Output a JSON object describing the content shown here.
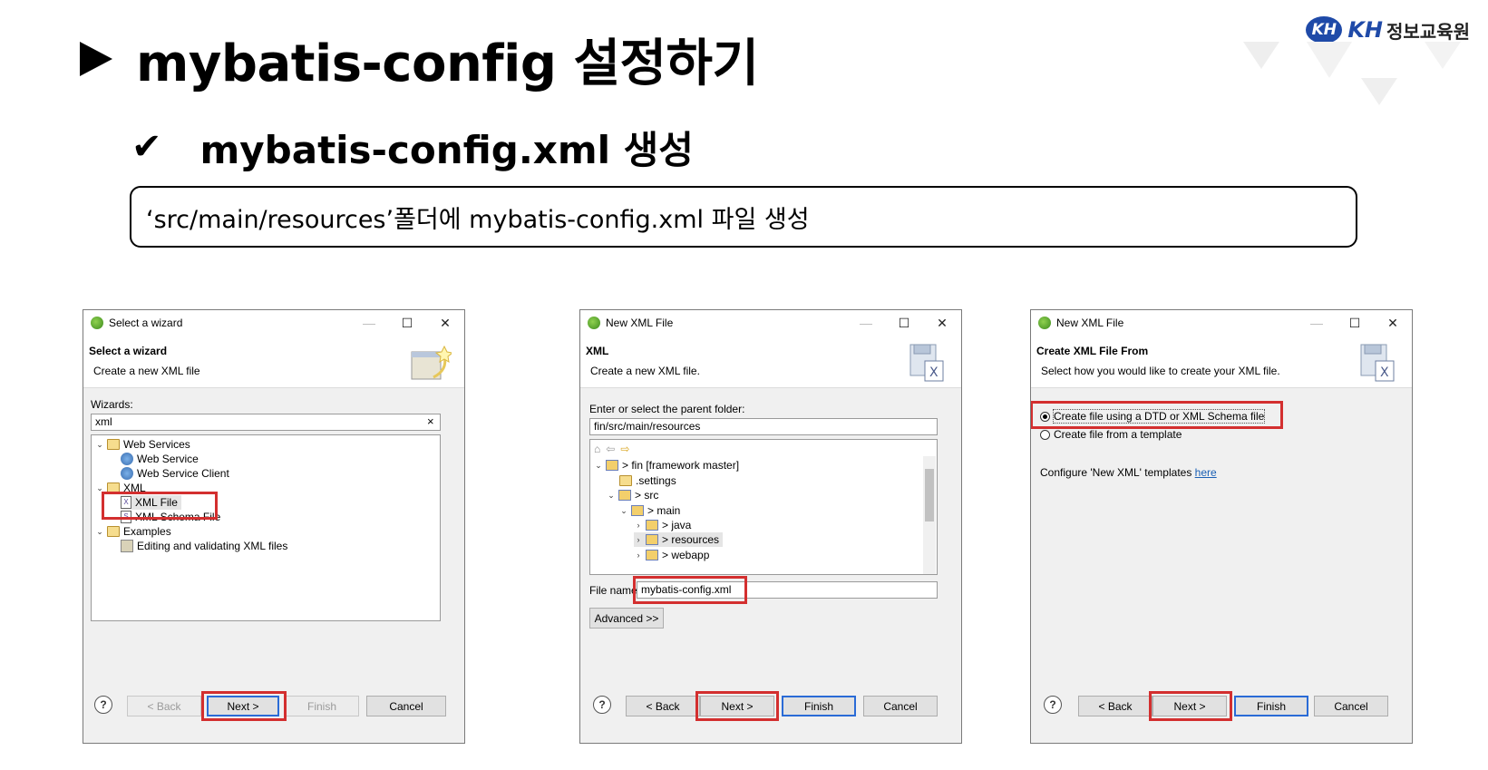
{
  "slide": {
    "title": "mybatis-config 설정하기",
    "subtitle_check": "✔",
    "subtitle": "mybatis-config.xml 생성",
    "note": "‘src/main/resources’폴더에 mybatis-config.xml 파일 생성",
    "logo": {
      "badge": "KH",
      "brand": "KH",
      "name": "정보교육원"
    }
  },
  "dialog1": {
    "window_title": "Select a wizard",
    "header_title": "Select a wizard",
    "header_desc": "Create a new XML file",
    "filter_label": "Wizards:",
    "filter_value": "xml",
    "filter_clear": "×",
    "tree": [
      {
        "label": "Web Services",
        "icon": "folder-open-icon",
        "chev": "⌄"
      },
      {
        "label": "Web Service",
        "icon": "web-service-icon"
      },
      {
        "label": "Web Service Client",
        "icon": "web-service-client-icon"
      },
      {
        "label": "XML",
        "icon": "folder-open-icon",
        "chev": "⌄"
      },
      {
        "label": "XML File",
        "icon": "xml-file-icon"
      },
      {
        "label": "XML Schema File",
        "icon": "xml-schema-icon"
      },
      {
        "label": "Examples",
        "icon": "folder-open-icon",
        "chev": "⌄"
      },
      {
        "label": "Editing and validating XML files",
        "icon": "example-icon"
      }
    ],
    "buttons": {
      "help": "?",
      "back": "< Back",
      "next": "Next >",
      "finish": "Finish",
      "cancel": "Cancel"
    }
  },
  "dialog2": {
    "window_title": "New XML File",
    "header_title": "XML",
    "header_desc": "Create a new XML file.",
    "parent_label": "Enter or select the parent folder:",
    "parent_value": "fin/src/main/resources",
    "tree": [
      {
        "label": "> fin [framework master]",
        "icon": "project-icon",
        "chev": "⌄"
      },
      {
        "label": ".settings",
        "icon": "folder-icon"
      },
      {
        "label": "> src",
        "icon": "folder-icon",
        "chev": "⌄"
      },
      {
        "label": "> main",
        "icon": "folder-icon",
        "chev": "⌄"
      },
      {
        "label": "> java",
        "icon": "folder-icon",
        "chev": "›"
      },
      {
        "label": "> resources",
        "icon": "folder-icon",
        "chev": "›"
      },
      {
        "label": "> webapp",
        "icon": "folder-icon",
        "chev": "›"
      }
    ],
    "file_name_label": "File name:",
    "file_name_value": "mybatis-config.xml",
    "advanced": "Advanced >>",
    "buttons": {
      "help": "?",
      "back": "< Back",
      "next": "Next >",
      "finish": "Finish",
      "cancel": "Cancel"
    }
  },
  "dialog3": {
    "window_title": "New XML File",
    "header_title": "Create XML File From",
    "header_desc": "Select how you would like to create your XML file.",
    "option1": "Create file using a DTD or XML Schema file",
    "option2": "Create file from a template",
    "configure_text": "Configure 'New XML' templates",
    "configure_link": "here",
    "buttons": {
      "help": "?",
      "back": "< Back",
      "next": "Next >",
      "finish": "Finish",
      "cancel": "Cancel"
    }
  },
  "window_controls": {
    "minimize": "—",
    "maximize": "☐",
    "close": "✕"
  },
  "colors": {
    "highlight": "#d32f2f",
    "default_button": "#2a6bd6",
    "brand": "#1f4aa8"
  }
}
